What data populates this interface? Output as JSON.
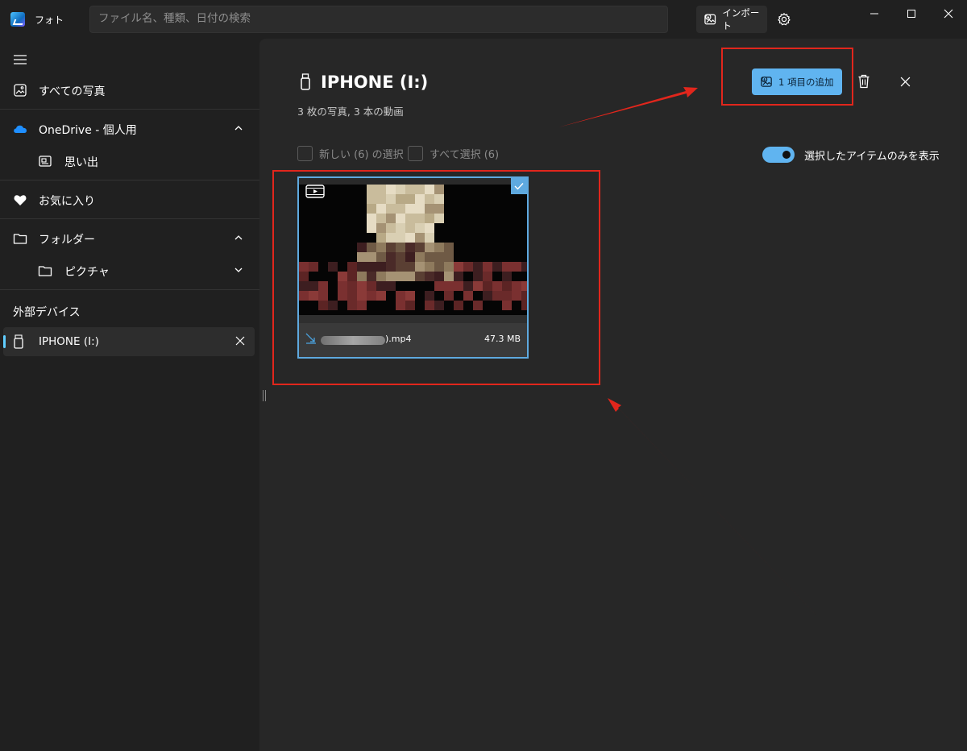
{
  "app": {
    "title": "フォト",
    "search_placeholder": "ファイル名、種類、日付の検索",
    "import_label": "インポート"
  },
  "sidebar": {
    "all_photos": "すべての写真",
    "onedrive": "OneDrive - 個人用",
    "memories": "思い出",
    "favorites": "お気に入り",
    "folders": "フォルダー",
    "pictures": "ピクチャ",
    "external_devices": "外部デバイス",
    "device_name": "IPHONE (I:)"
  },
  "main": {
    "device_title": "IPHONE (I:)",
    "device_summary": "3 枚の写真, 3 本の動画",
    "add_button": "1 項目の追加",
    "select_new": "新しい (6) の選択",
    "select_all": "すべて選択 (6)",
    "show_selected_only": "選択したアイテムのみを表示",
    "show_selected_only_on": true,
    "file": {
      "name_suffix": ").mp4",
      "size": "47.3 MB",
      "selected": true
    }
  },
  "colors": {
    "accent": "#60b4f0",
    "annotation": "#e1261c",
    "background": "#202020",
    "panel": "#272727"
  },
  "icons": {
    "app": "photos-logo-icon",
    "import": "import-photo-icon",
    "settings": "gear-icon",
    "menu": "hamburger-icon",
    "delete": "trash-icon",
    "close": "close-icon",
    "device": "usb-drive-icon",
    "video": "video-icon"
  }
}
